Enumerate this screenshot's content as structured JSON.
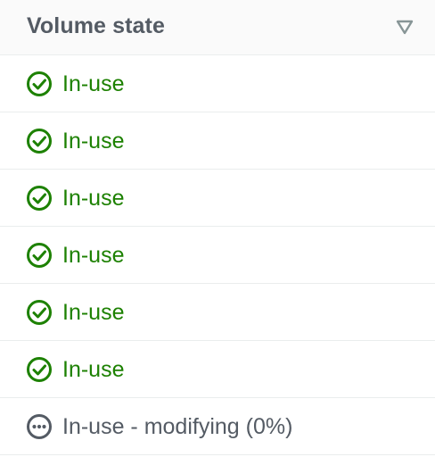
{
  "column": {
    "header": "Volume state",
    "sort_icon": "sort-descending-triangle-icon"
  },
  "colors": {
    "success": "#1d8102",
    "pending": "#545b64",
    "header_text": "#545b64",
    "divider": "#eaeded"
  },
  "rows": [
    {
      "status": "success",
      "icon": "check-circle-icon",
      "label": "In-use"
    },
    {
      "status": "success",
      "icon": "check-circle-icon",
      "label": "In-use"
    },
    {
      "status": "success",
      "icon": "check-circle-icon",
      "label": "In-use"
    },
    {
      "status": "success",
      "icon": "check-circle-icon",
      "label": "In-use"
    },
    {
      "status": "success",
      "icon": "check-circle-icon",
      "label": "In-use"
    },
    {
      "status": "success",
      "icon": "check-circle-icon",
      "label": "In-use"
    },
    {
      "status": "pending",
      "icon": "in-progress-ellipsis-icon",
      "label": "In-use - modifying (0%)"
    }
  ]
}
